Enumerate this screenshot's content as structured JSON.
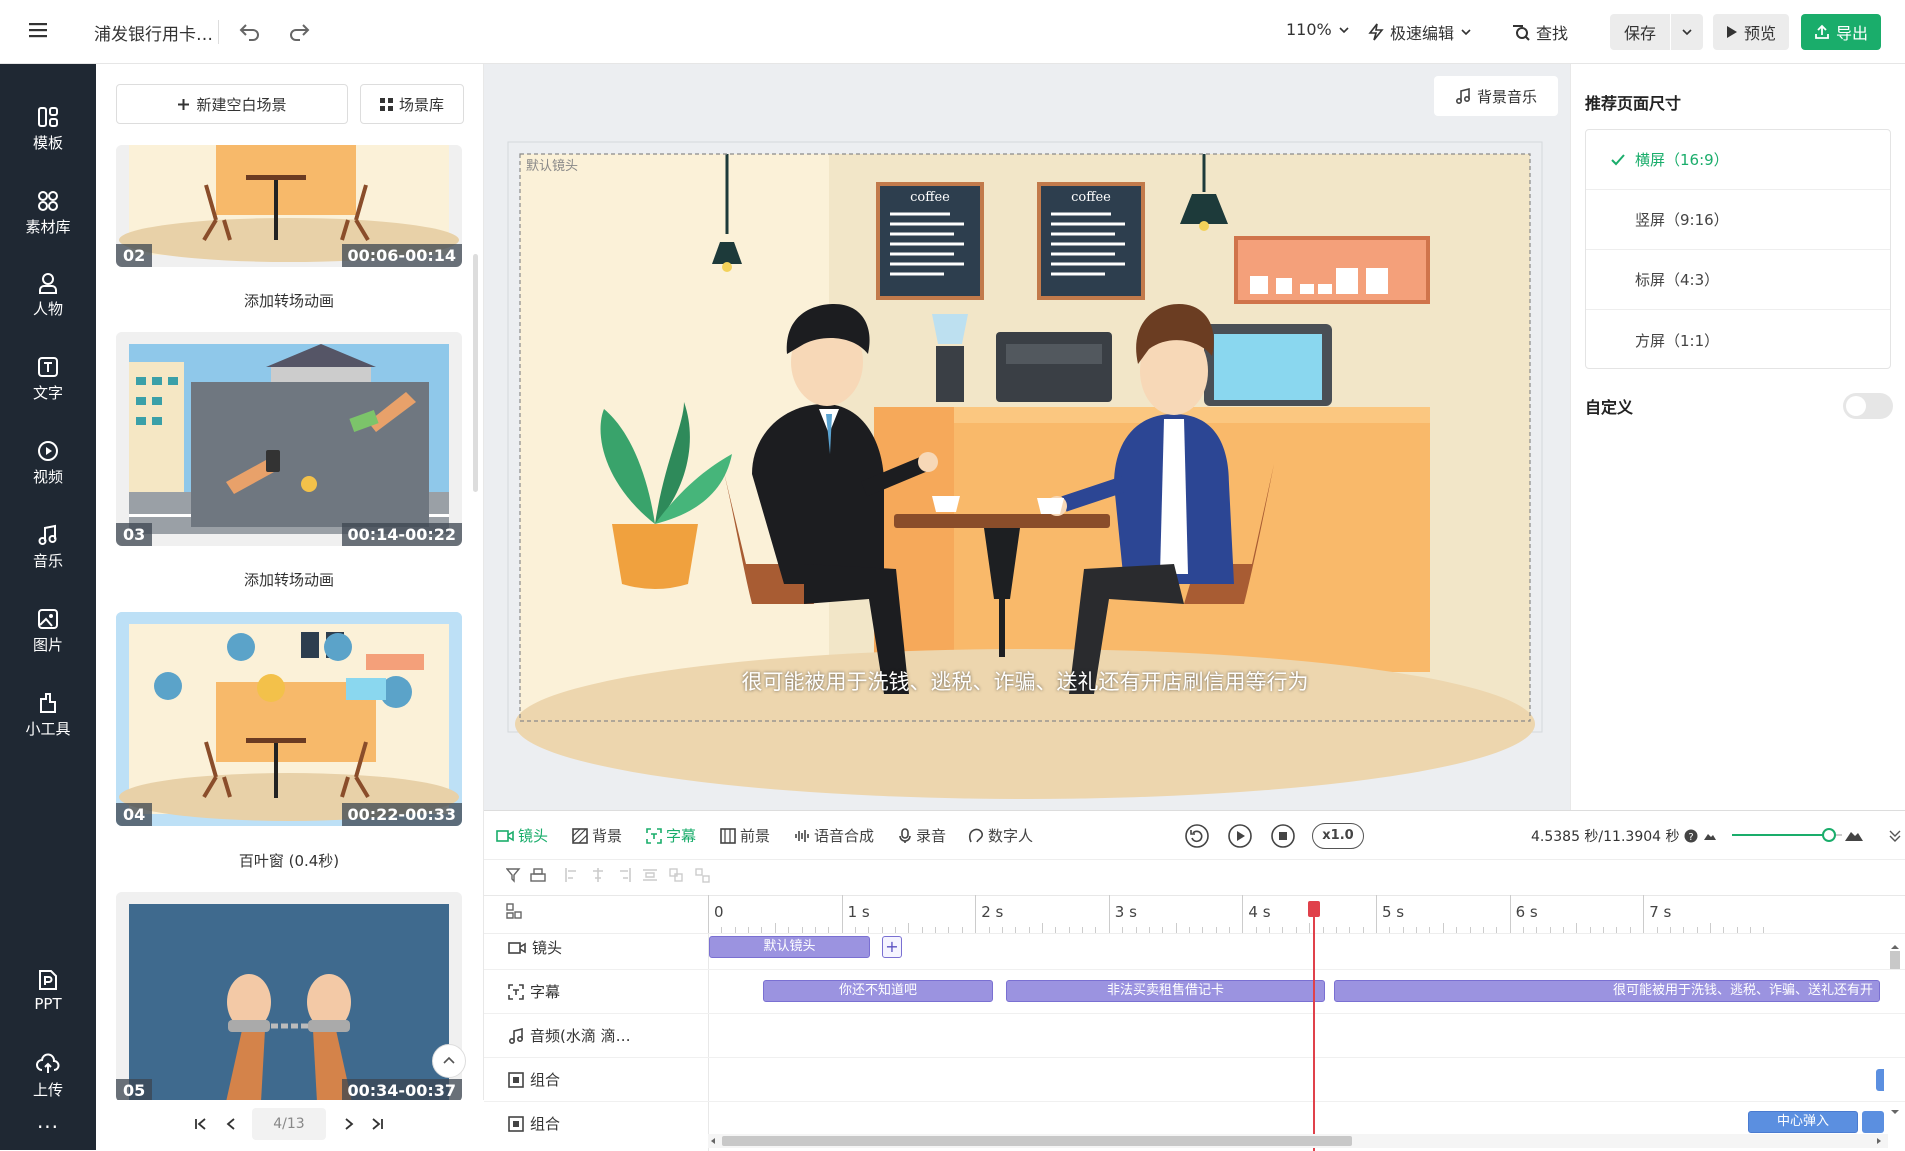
{
  "topbar": {
    "doc_title": "浦发银行用卡…",
    "zoom": "110%",
    "edit_mode": "极速编辑",
    "find": "查找",
    "save": "保存",
    "preview": "预览",
    "export": "导出"
  },
  "sidebar": {
    "items": [
      {
        "label": "模板",
        "icon": "template-icon"
      },
      {
        "label": "素材库",
        "icon": "assets-icon"
      },
      {
        "label": "人物",
        "icon": "person-icon"
      },
      {
        "label": "文字",
        "icon": "text-icon"
      },
      {
        "label": "视频",
        "icon": "video-icon"
      },
      {
        "label": "音乐",
        "icon": "music-icon"
      },
      {
        "label": "图片",
        "icon": "image-icon"
      },
      {
        "label": "小工具",
        "icon": "tools-icon"
      }
    ],
    "bottom": [
      {
        "label": "PPT",
        "icon": "ppt-icon"
      },
      {
        "label": "上传",
        "icon": "upload-icon"
      }
    ],
    "more": "···"
  },
  "scene_panel": {
    "new_scene": "新建空白场景",
    "library": "场景库",
    "scenes": [
      {
        "num": "02",
        "time": "00:06-00:14",
        "transition": "添加转场动画"
      },
      {
        "num": "03",
        "time": "00:14-00:22",
        "transition": "添加转场动画"
      },
      {
        "num": "04",
        "time": "00:22-00:33",
        "transition": "百叶窗 (0.4秒)"
      },
      {
        "num": "05",
        "time": "00:34-00:37",
        "transition": ""
      }
    ],
    "pager": "4/13"
  },
  "canvas": {
    "bgm": "背景音乐",
    "camera_label": "默认镜头",
    "subtitle": "很可能被用于洗钱、逃税、诈骗、送礼还有开店刷信用等行为",
    "menu_word": "coffee"
  },
  "right_panel": {
    "title": "推荐页面尺寸",
    "options": [
      "横屏（16:9）",
      "竖屏（9:16）",
      "标屏（4:3）",
      "方屏（1:1）"
    ],
    "custom": "自定义",
    "custom_enabled": false
  },
  "timeline": {
    "tabs": [
      "镜头",
      "背景",
      "字幕",
      "前景",
      "语音合成",
      "录音",
      "数字人"
    ],
    "speed": "x1.0",
    "time_display": "4.5385 秒/11.3904 秒",
    "zoom_level": 0.88,
    "ruler": [
      "0",
      "1 s",
      "2 s",
      "3 s",
      "4 s",
      "5 s",
      "6 s",
      "7 s"
    ],
    "playhead_seconds": 4.5385,
    "tracks": [
      {
        "label": "镜头",
        "icon": "camera-icon"
      },
      {
        "label": "字幕",
        "icon": "subtitle-icon"
      },
      {
        "label": "音频(水滴 滴…",
        "icon": "audio-icon"
      },
      {
        "label": "组合",
        "icon": "group-icon"
      },
      {
        "label": "组合",
        "icon": "group-icon"
      }
    ],
    "clips": {
      "camera": "默认镜头",
      "subtitles": [
        "你还不知道吧",
        "非法买卖租售借记卡",
        "很可能被用于洗钱、逃税、诈骗、送礼还有开"
      ],
      "group2": "中心弹入"
    }
  },
  "colors": {
    "accent": "#1aad6b",
    "sidebar_bg": "#1f2833",
    "clip": "#9b93e0",
    "playhead": "#e0414b"
  }
}
